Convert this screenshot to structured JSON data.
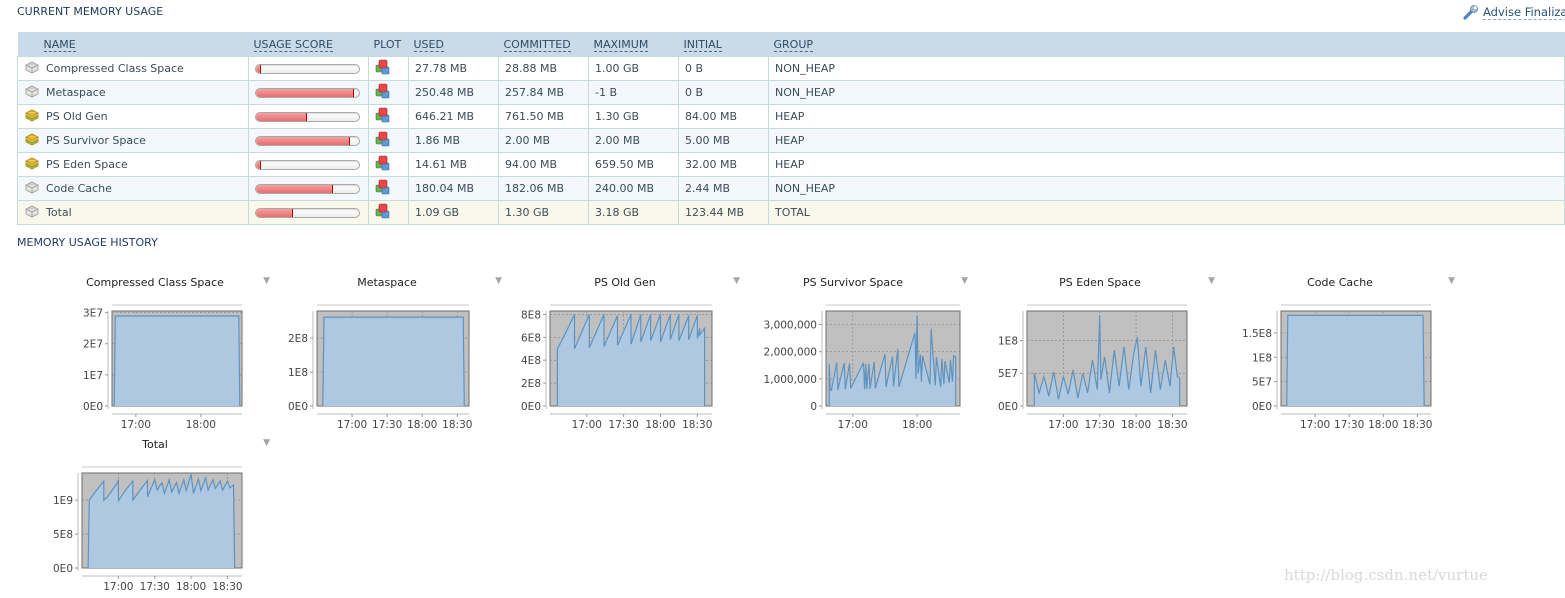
{
  "current": {
    "title": "CURRENT MEMORY USAGE",
    "advise_link": "Advise Finalizat",
    "columns": [
      "NAME",
      "USAGE SCORE",
      "PLOT",
      "USED",
      "COMMITTED",
      "MAXIMUM",
      "INITIAL",
      "GROUP"
    ],
    "rows": [
      {
        "name": "Compressed Class Space",
        "icon": "gray-block-icon",
        "usage_score": 0.04,
        "used": "27.78 MB",
        "committed": "28.88 MB",
        "maximum": "1.00 GB",
        "initial": "0 B",
        "group": "NON_HEAP"
      },
      {
        "name": "Metaspace",
        "icon": "gray-block-icon",
        "usage_score": 0.94,
        "used": "250.48 MB",
        "committed": "257.84 MB",
        "maximum": "-1 B",
        "initial": "0 B",
        "group": "NON_HEAP"
      },
      {
        "name": "PS Old Gen",
        "icon": "yellow-block-icon",
        "usage_score": 0.49,
        "used": "646.21 MB",
        "committed": "761.50 MB",
        "maximum": "1.30 GB",
        "initial": "84.00 MB",
        "group": "HEAP"
      },
      {
        "name": "PS Survivor Space",
        "icon": "yellow-block-icon",
        "usage_score": 0.9,
        "used": "1.86 MB",
        "committed": "2.00 MB",
        "maximum": "2.00 MB",
        "initial": "5.00 MB",
        "group": "HEAP"
      },
      {
        "name": "PS Eden Space",
        "icon": "yellow-block-icon",
        "usage_score": 0.04,
        "used": "14.61 MB",
        "committed": "94.00 MB",
        "maximum": "659.50 MB",
        "initial": "32.00 MB",
        "group": "HEAP"
      },
      {
        "name": "Code Cache",
        "icon": "gray-block-icon",
        "usage_score": 0.74,
        "used": "180.04 MB",
        "committed": "182.06 MB",
        "maximum": "240.00 MB",
        "initial": "2.44 MB",
        "group": "NON_HEAP"
      },
      {
        "name": "Total",
        "icon": "gray-block-icon",
        "usage_score": 0.35,
        "used": "1.09 GB",
        "committed": "1.30 GB",
        "maximum": "3.18 GB",
        "initial": "123.44 MB",
        "group": "TOTAL"
      }
    ]
  },
  "history": {
    "title": "MEMORY USAGE HISTORY"
  },
  "watermark": "http://blog.csdn.net/vurtue",
  "colors": {
    "fill": "#adc8e0",
    "line": "#5f93bf",
    "plot_bg": "#c0c0c0",
    "bar_fill": "#e86d6d"
  },
  "chart_data": [
    {
      "type": "area",
      "title": "Compressed Class Space",
      "x_range": [
        "16:38",
        "18:38"
      ],
      "xticks": [
        "17:00",
        "18:00"
      ],
      "yticks": [
        "0E0",
        "1E7",
        "2E7",
        "3E7"
      ],
      "ylim": [
        0,
        30500000
      ],
      "x": [
        "16:40",
        "16:41",
        "18:35",
        "18:36"
      ],
      "values": [
        0,
        28880000,
        28880000,
        0
      ]
    },
    {
      "type": "area",
      "title": "Metaspace",
      "x_range": [
        "16:30",
        "18:40"
      ],
      "xticks": [
        "17:00",
        "17:30",
        "18:00",
        "18:30"
      ],
      "yticks": [
        "0E0",
        "1E8",
        "2E8"
      ],
      "ylim": [
        0,
        280000000
      ],
      "x": [
        "16:35",
        "16:36",
        "18:35",
        "18:36"
      ],
      "values": [
        0,
        262000000,
        262000000,
        0
      ]
    },
    {
      "type": "area",
      "title": "PS Old Gen",
      "x_range": [
        "16:30",
        "18:42"
      ],
      "xticks": [
        "17:00",
        "17:30",
        "18:00",
        "18:30"
      ],
      "yticks": [
        "0E0",
        "2E8",
        "4E8",
        "6E8",
        "8E8"
      ],
      "ylim": [
        0,
        830000000
      ],
      "x": [
        "16:36",
        "16:36",
        "16:41",
        "16:50",
        "16:50",
        "17:02",
        "17:02",
        "17:14",
        "17:14",
        "17:25",
        "17:25",
        "17:36",
        "17:36",
        "17:44",
        "17:44",
        "17:52",
        "17:52",
        "18:00",
        "18:00",
        "18:08",
        "18:08",
        "18:15",
        "18:15",
        "18:23",
        "18:23",
        "18:30",
        "18:30",
        "18:32",
        "18:32",
        "18:36",
        "18:36"
      ],
      "values": [
        0,
        500000000,
        600000000,
        800000000,
        500000000,
        800000000,
        510000000,
        800000000,
        520000000,
        790000000,
        530000000,
        800000000,
        540000000,
        800000000,
        560000000,
        800000000,
        570000000,
        800000000,
        560000000,
        800000000,
        580000000,
        800000000,
        570000000,
        790000000,
        580000000,
        790000000,
        590000000,
        680000000,
        620000000,
        680000000,
        0
      ]
    },
    {
      "type": "area",
      "title": "PS Survivor Space",
      "x_range": [
        "16:35",
        "18:40"
      ],
      "xticks": [
        "17:00",
        "18:00"
      ],
      "yticks": [
        "0",
        "1,000,000",
        "2,000,000",
        "3,000,000"
      ],
      "ylim": [
        0,
        3500000
      ],
      "x": [
        "16:38",
        "16:38",
        "16:39",
        "16:40",
        "16:45",
        "16:46",
        "16:52",
        "16:53",
        "16:57",
        "16:58",
        "17:10",
        "17:11",
        "17:12",
        "17:13",
        "17:15",
        "17:16",
        "17:20",
        "17:21",
        "17:30",
        "17:31",
        "17:37",
        "17:38",
        "17:42",
        "17:43",
        "17:58",
        "17:59",
        "18:00",
        "18:01",
        "18:03",
        "18:04",
        "18:05",
        "18:12",
        "18:13",
        "18:17",
        "18:18",
        "18:22",
        "18:23",
        "18:25",
        "18:26",
        "18:30",
        "18:31",
        "18:33",
        "18:34",
        "18:36",
        "18:36"
      ],
      "values": [
        0,
        1550000,
        600000,
        580000,
        1600000,
        600000,
        1580000,
        620000,
        1570000,
        650000,
        1600000,
        620000,
        1550000,
        630000,
        1560000,
        640000,
        1620000,
        650000,
        1920000,
        700000,
        1820000,
        720000,
        2100000,
        700000,
        2700000,
        1000000,
        3350000,
        1200000,
        1900000,
        900000,
        1850000,
        800000,
        2850000,
        750000,
        1800000,
        700000,
        1750000,
        800000,
        1650000,
        850000,
        1700000,
        900000,
        1850000,
        1800000,
        0
      ]
    },
    {
      "type": "area",
      "title": "PS Eden Space",
      "x_range": [
        "16:30",
        "18:42"
      ],
      "xticks": [
        "17:00",
        "17:30",
        "18:00",
        "18:30"
      ],
      "yticks": [
        "0E0",
        "5E7",
        "1E8"
      ],
      "ylim": [
        0,
        145000000
      ],
      "x": [
        "16:36",
        "16:36",
        "16:40",
        "16:44",
        "16:48",
        "16:52",
        "16:56",
        "17:00",
        "17:04",
        "17:08",
        "17:12",
        "17:16",
        "17:20",
        "17:24",
        "17:28",
        "17:30",
        "17:31",
        "17:34",
        "17:38",
        "17:42",
        "17:46",
        "17:50",
        "17:54",
        "17:58",
        "18:01",
        "18:04",
        "18:08",
        "18:12",
        "18:16",
        "18:20",
        "18:24",
        "18:28",
        "18:31",
        "18:34",
        "18:36",
        "18:36"
      ],
      "values": [
        0,
        50000000,
        20000000,
        45000000,
        15000000,
        52000000,
        10000000,
        45000000,
        18000000,
        55000000,
        12000000,
        50000000,
        20000000,
        70000000,
        25000000,
        138000000,
        40000000,
        75000000,
        20000000,
        85000000,
        30000000,
        90000000,
        25000000,
        80000000,
        105000000,
        30000000,
        90000000,
        20000000,
        85000000,
        25000000,
        70000000,
        30000000,
        90000000,
        45000000,
        42000000,
        0
      ]
    },
    {
      "type": "area",
      "title": "Code Cache",
      "x_range": [
        "16:30",
        "18:42"
      ],
      "xticks": [
        "17:00",
        "17:30",
        "18:00",
        "18:30"
      ],
      "yticks": [
        "0E0",
        "5E7",
        "1E8",
        "1.5E8"
      ],
      "ylim": [
        0,
        195000000
      ],
      "x": [
        "16:35",
        "16:36",
        "18:35",
        "18:36"
      ],
      "values": [
        0,
        186000000,
        186000000,
        0
      ]
    },
    {
      "type": "area",
      "title": "Total",
      "x_range": [
        "16:30",
        "18:42"
      ],
      "xticks": [
        "17:00",
        "17:30",
        "18:00",
        "18:30"
      ],
      "yticks": [
        "0E0",
        "5E8",
        "1E9"
      ],
      "ylim": [
        0,
        1400000000
      ],
      "x": [
        "16:35",
        "16:36",
        "16:40",
        "16:48",
        "16:48",
        "16:51",
        "16:59",
        "17:00",
        "17:00",
        "17:06",
        "17:12",
        "17:12",
        "17:18",
        "17:24",
        "17:24",
        "17:30",
        "17:32",
        "17:36",
        "17:38",
        "17:42",
        "17:44",
        "17:48",
        "17:50",
        "17:54",
        "17:56",
        "18:00",
        "18:02",
        "18:06",
        "18:08",
        "18:12",
        "18:14",
        "18:18",
        "18:20",
        "18:24",
        "18:26",
        "18:30",
        "18:32",
        "18:35",
        "18:36"
      ],
      "values": [
        0,
        1000000000,
        1100000000,
        1280000000,
        1000000000,
        1050000000,
        1250000000,
        1300000000,
        990000000,
        1150000000,
        1280000000,
        1000000000,
        1150000000,
        1290000000,
        1050000000,
        1300000000,
        1150000000,
        1260000000,
        1100000000,
        1300000000,
        1120000000,
        1260000000,
        1100000000,
        1300000000,
        1140000000,
        1380000000,
        1100000000,
        1310000000,
        1140000000,
        1330000000,
        1150000000,
        1300000000,
        1170000000,
        1280000000,
        1150000000,
        1280000000,
        1180000000,
        1220000000,
        0
      ]
    }
  ]
}
